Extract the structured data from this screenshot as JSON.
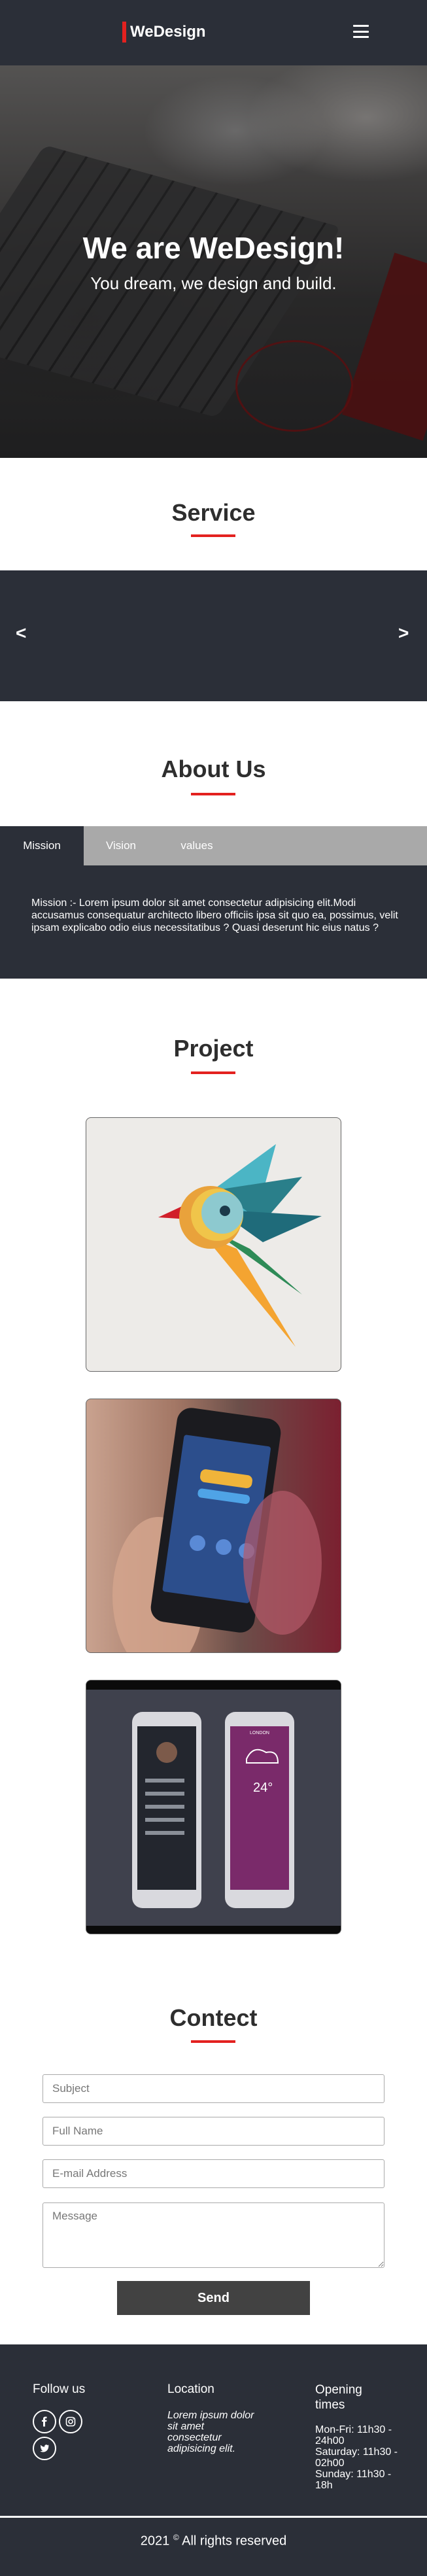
{
  "brand": {
    "name": "WeDesign",
    "accent": "#e3211f"
  },
  "nav": {
    "menu_icon": "hamburger-menu-icon"
  },
  "hero": {
    "title": "We are WeDesign!",
    "subtitle": "You dream, we design and build."
  },
  "service": {
    "title": "Service",
    "prev": "<",
    "next": ">"
  },
  "about": {
    "title": "About Us",
    "tabs": [
      {
        "label": "Mission",
        "active": true
      },
      {
        "label": "Vision",
        "active": false
      },
      {
        "label": "values",
        "active": false
      }
    ],
    "content": "Mission :- Lorem ipsum dolor sit amet consectetur adipisicing elit.Modi accusamus consequatur architecto libero officiis ipsa sit quo ea, possimus, velit ipsam explicabo odio eius necessitatibus ? Quasi deserunt hic eius natus ?"
  },
  "project": {
    "title": "Project",
    "items": [
      {
        "image": "colorful-bird-logo"
      },
      {
        "image": "hand-holding-phone-app"
      },
      {
        "image": "two-phone-app-mockups"
      }
    ],
    "mock": {
      "weather_temp": "24°",
      "weather_city": "LONDON"
    }
  },
  "contact": {
    "title": "Contect",
    "subject_placeholder": "Subject",
    "name_placeholder": "Full Name",
    "email_placeholder": "E-mail Address",
    "message_placeholder": "Message",
    "send_label": "Send"
  },
  "footer": {
    "follow_title": "Follow us",
    "social_icons": [
      "facebook-icon",
      "instagram-icon",
      "twitter-icon"
    ],
    "location_title": "Location",
    "location_text": "Lorem ipsum dolor sit amet consectetur adipisicing elit.",
    "hours_title": "Opening times",
    "hours": [
      "Mon-Fri: 11h30 - 24h00",
      "Saturday: 11h30 - 02h00",
      "Sunday: 11h30 - 18h"
    ],
    "copyright_year": "2021",
    "copyright_symbol": "©",
    "copyright_text": "All rights reserved"
  },
  "colors": {
    "dark": "#2b2f38",
    "tab_bar": "#a9a9a9",
    "button": "#424242",
    "accent": "#e3211f"
  }
}
